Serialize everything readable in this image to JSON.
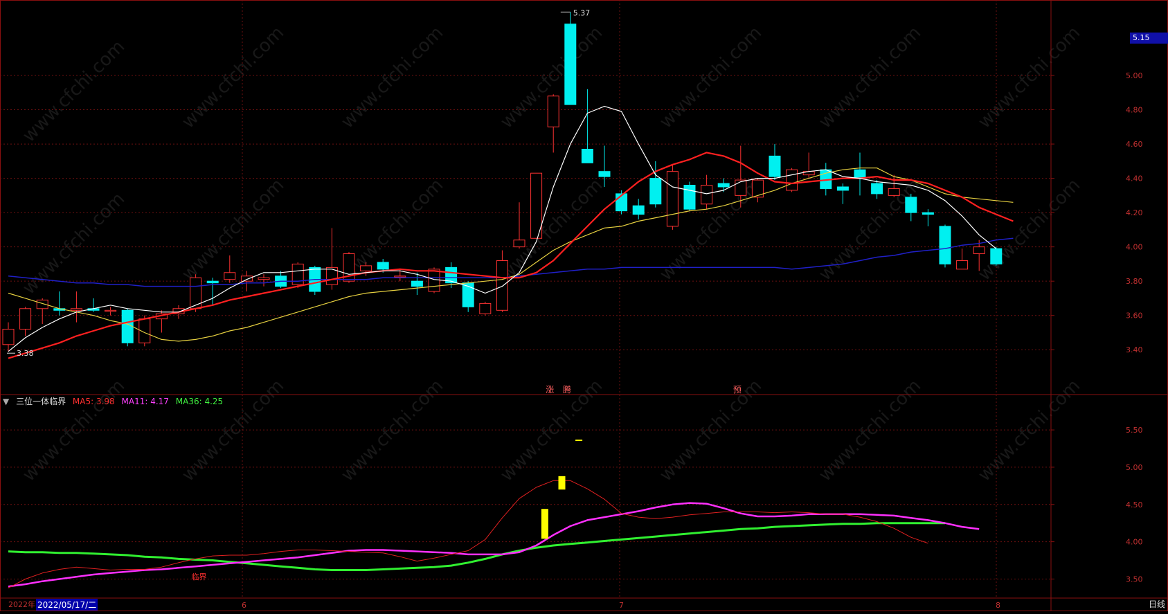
{
  "colors": {
    "up": "#ff3232",
    "down": "#00f0f0",
    "grid": "#6e1010",
    "axis_text": "#c03030",
    "ma5_price": "#ffffff",
    "ma10_price": "#ff2020",
    "ma20_price": "#e6d040",
    "ma60_price": "#2020c8",
    "ind_ma5": "#e02020",
    "ind_ma11": "#ff30ff",
    "ind_ma36": "#30f030",
    "signal": "#ffff00"
  },
  "header": {
    "indicator_name": "三位一体临界",
    "ma5_label": "MA5: 3.98",
    "ma11_label": "MA11: 4.17",
    "ma36_label": "MA36: 4.25"
  },
  "footer": {
    "year": "2022年",
    "date": "2022/05/17/二",
    "timeframe": "日线",
    "months": [
      "6",
      "7",
      "8"
    ]
  },
  "price_axis": {
    "current_price": "5.15",
    "ticks": [
      "5.00",
      "4.80",
      "4.60",
      "4.40",
      "4.20",
      "4.00",
      "3.80",
      "3.60",
      "3.40"
    ]
  },
  "indicator_axis": {
    "ticks": [
      "5.50",
      "5.00",
      "4.50",
      "4.00",
      "3.50"
    ]
  },
  "annotations": {
    "high_label": "5.37",
    "low_label": "3.38",
    "markers": [
      "涨",
      "腾",
      "预"
    ],
    "indicator_marker": "临界"
  },
  "watermark": "www.cfchi.com",
  "chart_data": {
    "type": "candlestick",
    "price_range": [
      3.3,
      5.42
    ],
    "indicator_range": [
      3.3,
      5.9
    ],
    "candles": [
      {
        "o": 3.43,
        "h": 3.56,
        "l": 3.39,
        "c": 3.52
      },
      {
        "o": 3.52,
        "h": 3.65,
        "l": 3.48,
        "c": 3.64
      },
      {
        "o": 3.64,
        "h": 3.7,
        "l": 3.55,
        "c": 3.69
      },
      {
        "o": 3.64,
        "h": 3.74,
        "l": 3.6,
        "c": 3.63
      },
      {
        "o": 3.63,
        "h": 3.74,
        "l": 3.56,
        "c": 3.64
      },
      {
        "o": 3.64,
        "h": 3.7,
        "l": 3.62,
        "c": 3.63
      },
      {
        "o": 3.63,
        "h": 3.65,
        "l": 3.6,
        "c": 3.63
      },
      {
        "o": 3.63,
        "h": 3.64,
        "l": 3.42,
        "c": 3.44
      },
      {
        "o": 3.44,
        "h": 3.6,
        "l": 3.42,
        "c": 3.58
      },
      {
        "o": 3.58,
        "h": 3.63,
        "l": 3.5,
        "c": 3.61
      },
      {
        "o": 3.61,
        "h": 3.66,
        "l": 3.58,
        "c": 3.64
      },
      {
        "o": 3.64,
        "h": 3.84,
        "l": 3.62,
        "c": 3.82
      },
      {
        "o": 3.8,
        "h": 3.82,
        "l": 3.66,
        "c": 3.79
      },
      {
        "o": 3.81,
        "h": 3.95,
        "l": 3.79,
        "c": 3.85
      },
      {
        "o": 3.8,
        "h": 3.86,
        "l": 3.74,
        "c": 3.83
      },
      {
        "o": 3.81,
        "h": 3.84,
        "l": 3.77,
        "c": 3.82
      },
      {
        "o": 3.83,
        "h": 3.86,
        "l": 3.76,
        "c": 3.77
      },
      {
        "o": 3.78,
        "h": 3.91,
        "l": 3.76,
        "c": 3.9
      },
      {
        "o": 3.88,
        "h": 3.89,
        "l": 3.72,
        "c": 3.74
      },
      {
        "o": 3.78,
        "h": 4.11,
        "l": 3.75,
        "c": 3.88
      },
      {
        "o": 3.8,
        "h": 3.97,
        "l": 3.79,
        "c": 3.96
      },
      {
        "o": 3.86,
        "h": 3.91,
        "l": 3.83,
        "c": 3.89
      },
      {
        "o": 3.91,
        "h": 3.93,
        "l": 3.85,
        "c": 3.87
      },
      {
        "o": 3.83,
        "h": 3.87,
        "l": 3.8,
        "c": 3.83
      },
      {
        "o": 3.8,
        "h": 3.85,
        "l": 3.72,
        "c": 3.77
      },
      {
        "o": 3.74,
        "h": 3.88,
        "l": 3.73,
        "c": 3.87
      },
      {
        "o": 3.88,
        "h": 3.91,
        "l": 3.76,
        "c": 3.79
      },
      {
        "o": 3.79,
        "h": 3.8,
        "l": 3.62,
        "c": 3.65
      },
      {
        "o": 3.61,
        "h": 3.68,
        "l": 3.6,
        "c": 3.67
      },
      {
        "o": 3.63,
        "h": 3.98,
        "l": 3.62,
        "c": 3.92
      },
      {
        "o": 4.0,
        "h": 4.26,
        "l": 3.99,
        "c": 4.04
      },
      {
        "o": 4.05,
        "h": 4.43,
        "l": 4.05,
        "c": 4.43
      },
      {
        "o": 4.7,
        "h": 4.89,
        "l": 4.55,
        "c": 4.88
      },
      {
        "o": 5.3,
        "h": 5.37,
        "l": 4.9,
        "c": 4.83
      },
      {
        "o": 4.57,
        "h": 4.92,
        "l": 4.49,
        "c": 4.49
      },
      {
        "o": 4.44,
        "h": 4.59,
        "l": 4.35,
        "c": 4.41
      },
      {
        "o": 4.31,
        "h": 4.33,
        "l": 4.19,
        "c": 4.21
      },
      {
        "o": 4.24,
        "h": 4.28,
        "l": 4.16,
        "c": 4.19
      },
      {
        "o": 4.4,
        "h": 4.5,
        "l": 4.23,
        "c": 4.25
      },
      {
        "o": 4.12,
        "h": 4.48,
        "l": 4.1,
        "c": 4.44
      },
      {
        "o": 4.36,
        "h": 4.38,
        "l": 4.21,
        "c": 4.22
      },
      {
        "o": 4.25,
        "h": 4.42,
        "l": 4.22,
        "c": 4.36
      },
      {
        "o": 4.37,
        "h": 4.4,
        "l": 4.32,
        "c": 4.35
      },
      {
        "o": 4.3,
        "h": 4.59,
        "l": 4.23,
        "c": 4.39
      },
      {
        "o": 4.29,
        "h": 4.4,
        "l": 4.26,
        "c": 4.39
      },
      {
        "o": 4.53,
        "h": 4.6,
        "l": 4.39,
        "c": 4.41
      },
      {
        "o": 4.33,
        "h": 4.46,
        "l": 4.32,
        "c": 4.45
      },
      {
        "o": 4.42,
        "h": 4.55,
        "l": 4.4,
        "c": 4.44
      },
      {
        "o": 4.45,
        "h": 4.49,
        "l": 4.3,
        "c": 4.34
      },
      {
        "o": 4.35,
        "h": 4.37,
        "l": 4.25,
        "c": 4.33
      },
      {
        "o": 4.45,
        "h": 4.55,
        "l": 4.3,
        "c": 4.4
      },
      {
        "o": 4.37,
        "h": 4.39,
        "l": 4.28,
        "c": 4.31
      },
      {
        "o": 4.3,
        "h": 4.42,
        "l": 4.29,
        "c": 4.34
      },
      {
        "o": 4.29,
        "h": 4.31,
        "l": 4.15,
        "c": 4.2
      },
      {
        "o": 4.2,
        "h": 4.22,
        "l": 4.12,
        "c": 4.19
      },
      {
        "o": 4.12,
        "h": 4.13,
        "l": 3.88,
        "c": 3.9
      },
      {
        "o": 3.87,
        "h": 3.99,
        "l": 3.87,
        "c": 3.92
      },
      {
        "o": 3.96,
        "h": 4.04,
        "l": 3.86,
        "c": 4.0
      },
      {
        "o": 3.99,
        "h": 4.0,
        "l": 3.89,
        "c": 3.9
      }
    ],
    "ma5": [
      3.39,
      3.47,
      3.53,
      3.58,
      3.62,
      3.64,
      3.66,
      3.64,
      3.63,
      3.62,
      3.62,
      3.66,
      3.7,
      3.76,
      3.81,
      3.85,
      3.85,
      3.86,
      3.87,
      3.87,
      3.84,
      3.85,
      3.86,
      3.86,
      3.84,
      3.81,
      3.8,
      3.77,
      3.73,
      3.77,
      3.85,
      4.03,
      4.35,
      4.6,
      4.78,
      4.82,
      4.79,
      4.6,
      4.42,
      4.35,
      4.33,
      4.31,
      4.33,
      4.38,
      4.4,
      4.4,
      4.42,
      4.44,
      4.45,
      4.41,
      4.4,
      4.38,
      4.37,
      4.36,
      4.33,
      4.27,
      4.18,
      4.07,
      3.99
    ],
    "ma10": [
      3.35,
      3.38,
      3.41,
      3.44,
      3.48,
      3.51,
      3.54,
      3.56,
      3.58,
      3.6,
      3.62,
      3.64,
      3.66,
      3.69,
      3.71,
      3.73,
      3.75,
      3.77,
      3.79,
      3.81,
      3.83,
      3.85,
      3.86,
      3.87,
      3.86,
      3.86,
      3.85,
      3.84,
      3.83,
      3.82,
      3.82,
      3.85,
      3.92,
      4.02,
      4.12,
      4.22,
      4.3,
      4.38,
      4.44,
      4.48,
      4.51,
      4.55,
      4.53,
      4.49,
      4.43,
      4.38,
      4.37,
      4.38,
      4.39,
      4.4,
      4.4,
      4.41,
      4.39,
      4.39,
      4.37,
      4.33,
      4.29,
      4.23,
      4.19,
      4.15
    ],
    "ma20": [
      3.73,
      3.7,
      3.67,
      3.64,
      3.62,
      3.6,
      3.57,
      3.55,
      3.5,
      3.46,
      3.45,
      3.46,
      3.48,
      3.51,
      3.53,
      3.56,
      3.59,
      3.62,
      3.65,
      3.68,
      3.71,
      3.73,
      3.74,
      3.75,
      3.76,
      3.77,
      3.78,
      3.79,
      3.8,
      3.81,
      3.84,
      3.91,
      3.98,
      4.03,
      4.07,
      4.11,
      4.12,
      4.15,
      4.17,
      4.19,
      4.21,
      4.22,
      4.24,
      4.27,
      4.3,
      4.33,
      4.37,
      4.4,
      4.43,
      4.45,
      4.46,
      4.46,
      4.41,
      4.39,
      4.35,
      4.31,
      4.29,
      4.28,
      4.27,
      4.26
    ],
    "ma60": [
      3.83,
      3.82,
      3.81,
      3.8,
      3.79,
      3.79,
      3.78,
      3.78,
      3.77,
      3.77,
      3.77,
      3.77,
      3.78,
      3.78,
      3.79,
      3.79,
      3.8,
      3.8,
      3.81,
      3.81,
      3.81,
      3.81,
      3.82,
      3.82,
      3.82,
      3.82,
      3.82,
      3.82,
      3.82,
      3.82,
      3.83,
      3.84,
      3.85,
      3.86,
      3.87,
      3.87,
      3.88,
      3.88,
      3.88,
      3.88,
      3.88,
      3.88,
      3.88,
      3.88,
      3.88,
      3.88,
      3.87,
      3.88,
      3.89,
      3.9,
      3.92,
      3.94,
      3.95,
      3.97,
      3.98,
      3.99,
      4.01,
      4.02,
      4.04,
      4.05
    ],
    "ind_ma5": [
      3.38,
      3.5,
      3.58,
      3.63,
      3.66,
      3.64,
      3.62,
      3.63,
      3.63,
      3.66,
      3.72,
      3.77,
      3.81,
      3.82,
      3.82,
      3.84,
      3.87,
      3.89,
      3.89,
      3.88,
      3.87,
      3.86,
      3.85,
      3.8,
      3.74,
      3.78,
      3.83,
      3.88,
      4.03,
      4.32,
      4.58,
      4.73,
      4.82,
      4.82,
      4.71,
      4.57,
      4.38,
      4.33,
      4.31,
      4.33,
      4.36,
      4.38,
      4.4,
      4.4,
      4.4,
      4.39,
      4.4,
      4.39,
      4.37,
      4.37,
      4.33,
      4.27,
      4.18,
      4.06,
      3.98
    ],
    "ind_ma11": [
      3.4,
      3.43,
      3.47,
      3.5,
      3.53,
      3.56,
      3.58,
      3.6,
      3.62,
      3.63,
      3.65,
      3.67,
      3.69,
      3.71,
      3.73,
      3.75,
      3.77,
      3.79,
      3.82,
      3.85,
      3.88,
      3.89,
      3.89,
      3.88,
      3.87,
      3.86,
      3.85,
      3.83,
      3.83,
      3.83,
      3.86,
      3.95,
      4.09,
      4.21,
      4.29,
      4.33,
      4.37,
      4.41,
      4.46,
      4.5,
      4.52,
      4.51,
      4.45,
      4.38,
      4.34,
      4.34,
      4.35,
      4.37,
      4.37,
      4.37,
      4.37,
      4.36,
      4.35,
      4.32,
      4.29,
      4.25,
      4.2,
      4.17
    ],
    "ind_ma36": [
      3.87,
      3.86,
      3.86,
      3.85,
      3.85,
      3.84,
      3.83,
      3.82,
      3.8,
      3.79,
      3.77,
      3.76,
      3.75,
      3.73,
      3.71,
      3.69,
      3.67,
      3.65,
      3.63,
      3.62,
      3.62,
      3.62,
      3.63,
      3.64,
      3.65,
      3.66,
      3.68,
      3.72,
      3.77,
      3.83,
      3.88,
      3.92,
      3.95,
      3.97,
      3.99,
      4.01,
      4.03,
      4.05,
      4.07,
      4.09,
      4.11,
      4.13,
      4.15,
      4.17,
      4.18,
      4.2,
      4.21,
      4.22,
      4.23,
      4.24,
      4.24,
      4.25,
      4.25,
      4.25,
      4.25,
      4.25
    ],
    "signals": [
      {
        "x": 31.5,
        "y0": 4.04,
        "y1": 4.44
      },
      {
        "x": 32.5,
        "y0": 4.7,
        "y1": 4.88
      },
      {
        "x": 33.5,
        "y0": 5.36,
        "y1": 5.37
      }
    ]
  }
}
